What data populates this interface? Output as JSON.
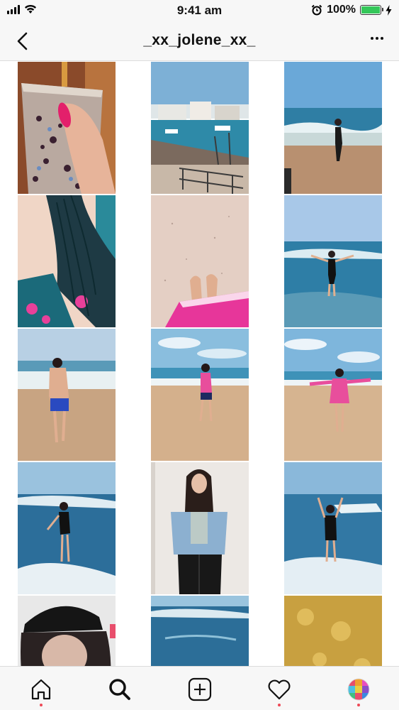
{
  "status_bar": {
    "time": "9:41 am",
    "battery_percent": "100%",
    "battery_level": 1.0,
    "signal_icon": "cellular-signal-icon",
    "wifi_icon": "wifi-icon",
    "alarm_icon": "alarm-clock-icon",
    "charging_icon": "charging-bolt-icon",
    "battery_color": "#34c759"
  },
  "nav": {
    "title": "_xx_jolene_xx_",
    "back_icon": "chevron-left-icon",
    "more_icon": "more-dots-icon"
  },
  "photos": [
    {
      "subject": "sparkly tumbler cup held with pink nails"
    },
    {
      "subject": "harbour with white buildings and boats"
    },
    {
      "subject": "girl walking on beach in waves"
    },
    {
      "subject": "wet dark hair and floral swimsuit"
    },
    {
      "subject": "feet in sand with pink towel"
    },
    {
      "subject": "girl in sea with arms spread"
    },
    {
      "subject": "girl in blue shorts on beach from behind"
    },
    {
      "subject": "girl in pink top posing on beach"
    },
    {
      "subject": "girl in pink top arms out on beach"
    },
    {
      "subject": "girl in black standing in shallow waves"
    },
    {
      "subject": "girl in denim jacket against white wall"
    },
    {
      "subject": "girl splashing water in sea"
    },
    {
      "subject": "girl in black cap selfie"
    },
    {
      "subject": "ocean waves with person in water"
    },
    {
      "subject": "hands on golden textured surface"
    }
  ],
  "tab_bar": {
    "items": [
      {
        "icon": "home-icon",
        "active": false,
        "notification": true
      },
      {
        "icon": "search-icon",
        "active": true,
        "notification": false
      },
      {
        "icon": "add-post-icon",
        "active": false,
        "notification": false
      },
      {
        "icon": "heart-icon",
        "active": false,
        "notification": true
      },
      {
        "icon": "profile-avatar-icon",
        "active": false,
        "notification": true
      }
    ],
    "notification_color": "#ed4956"
  }
}
